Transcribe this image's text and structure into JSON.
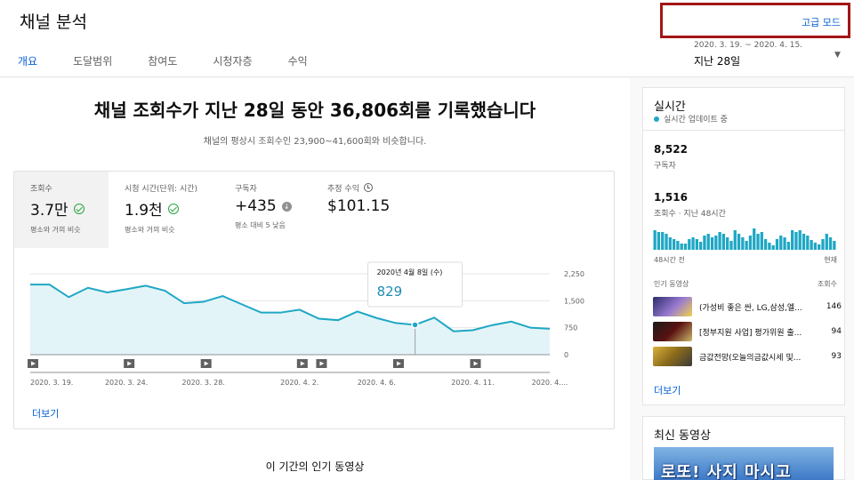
{
  "header": {
    "title": "채널 분석",
    "tabs": [
      "개요",
      "도달범위",
      "참여도",
      "시청자층",
      "수익"
    ],
    "advanced_mode": "고급 모드",
    "date_range": "2020. 3. 19. ~ 2020. 4. 15.",
    "date_label": "지난 28일"
  },
  "main": {
    "headline": "채널 조회수가 지난 28일 동안 36,806회를 기록했습니다",
    "subline": "채널의 평상시 조회수인 23,900~41,600회와 비슷합니다.",
    "metrics": [
      {
        "label": "조회수",
        "value": "3.7만",
        "note": "평소와 거의 비슷",
        "icon": "check-circle-icon"
      },
      {
        "label": "시청 시간(단위: 시간)",
        "value": "1.9천",
        "note": "평소와 거의 비슷",
        "icon": "check-circle-icon"
      },
      {
        "label": "구독자",
        "value": "+435",
        "note": "평소 대비 5 낮음",
        "icon": "arrow-down-circle-icon"
      },
      {
        "label": "추정 수익",
        "value": "$101.15",
        "note": "",
        "icon": "clock-icon"
      }
    ],
    "more": "더보기",
    "popular_title": "이 기간의 인기 동영상"
  },
  "chart_data": {
    "type": "area",
    "x_tick_labels": [
      "2020. 3. 19.",
      "2020. 3. 24.",
      "2020. 3. 28.",
      "2020. 4. 2.",
      "2020. 4. 6.",
      "2020. 4. 11.",
      "2020. 4...."
    ],
    "y_tick_labels": [
      "2,250",
      "1,500",
      "750",
      "0"
    ],
    "ylim": [
      0,
      2250
    ],
    "values": [
      1950,
      1950,
      1600,
      1860,
      1730,
      1820,
      1920,
      1780,
      1430,
      1470,
      1630,
      1400,
      1170,
      1170,
      1250,
      1000,
      960,
      1200,
      1020,
      880,
      829,
      1030,
      650,
      680,
      820,
      920,
      750,
      720
    ],
    "tooltip": {
      "date": "2020년 4월 8일 (수)",
      "value": "829"
    },
    "video_marker_days": [
      0,
      5,
      9,
      14,
      15,
      19,
      23
    ],
    "line_color": "#1ea7c4"
  },
  "realtime": {
    "title": "실시간",
    "live": "실시간 업데이트 중",
    "subscribers": "8,522",
    "subscribers_label": "구독자",
    "views": "1,516",
    "views_label": "조회수 · 지난 48시간",
    "axis_left": "48시간 전",
    "axis_right": "현재",
    "list_header": "인기 동영상",
    "list_header_right": "조회수",
    "bars": [
      22,
      20,
      20,
      18,
      14,
      12,
      10,
      7,
      7,
      12,
      14,
      12,
      9,
      16,
      18,
      14,
      16,
      20,
      18,
      14,
      10,
      22,
      18,
      14,
      10,
      16,
      24,
      18,
      20,
      12,
      8,
      5,
      12,
      16,
      14,
      9,
      22,
      20,
      22,
      18,
      16,
      11,
      8,
      6,
      12,
      18,
      14,
      10
    ],
    "videos": [
      {
        "title": "(가성비 좋은 싼, LG,삼성,엘...",
        "views": "146"
      },
      {
        "title": "[정부지원 사업] 평가위원 출...",
        "views": "94"
      },
      {
        "title": "금값전망(오늘의금값시세 및...",
        "views": "93"
      }
    ],
    "more": "더보기"
  },
  "recent": {
    "title": "최신 동영상",
    "thumb_text": "로또! 사지 마시고"
  }
}
